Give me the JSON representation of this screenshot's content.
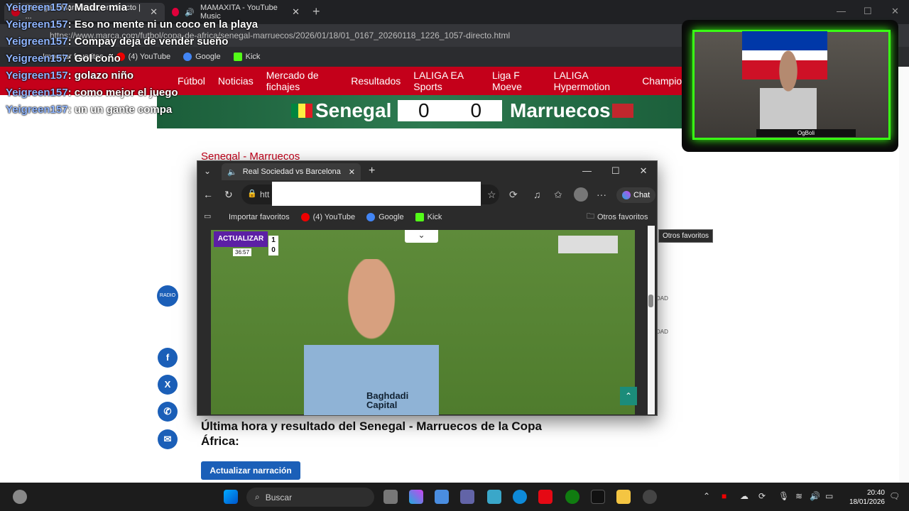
{
  "back_browser": {
    "tabs": [
      {
        "label": "Senegal - Marruecos, en directo | ..."
      },
      {
        "label": "MAMAXITA - YouTube Music"
      }
    ],
    "new_tab": "+",
    "url": "https://www.marca.com/futbol/copa-de-africa/senegal-marruecos/2026/01/18/01_0167_20260118_1226_1057-directo.html",
    "bookmarks": [
      "Importar favoritos",
      "(4) YouTube",
      "Google",
      "Kick"
    ]
  },
  "marca_nav": {
    "items": [
      "Fútbol",
      "Noticias",
      "Mercado de fichajes",
      "Resultados",
      "LALIGA EA Sports",
      "Liga F Moeve",
      "LALIGA Hypermotion",
      "Champions"
    ]
  },
  "score": {
    "home": "Senegal",
    "away": "Marruecos",
    "home_goals": "0",
    "away_goals": "0"
  },
  "article": {
    "top_title": "Senegal - Marruecos",
    "headline": "Última hora y resultado del Senegal - Marruecos de la Copa África:",
    "update_button": "Actualizar narración",
    "radio_label": "RADIO MARCA",
    "side_label_1": "DAD",
    "side_label_2": "DAD"
  },
  "social": {
    "facebook": "f",
    "x": "X",
    "whatsapp": "✆",
    "email": "✉"
  },
  "chat": [
    {
      "user": "Yeigreen157",
      "msg": "Madre mia"
    },
    {
      "user": "Yeigreen157",
      "msg": "Eso no mente ni un coco en la playa"
    },
    {
      "user": "Yeigreen157",
      "msg": "Compay deja de vender sueño"
    },
    {
      "user": "Yeigreen157",
      "msg": "Gol coño"
    },
    {
      "user": "Yeigreen157",
      "msg": "golazo niño"
    },
    {
      "user": "Yeigreen157",
      "msg": "como mejor el juego"
    },
    {
      "user": "Yeigreen157",
      "msg": "un "
    }
  ],
  "chat_overlap": "un gante compa",
  "webcam": {
    "name": "OgBoli"
  },
  "popup": {
    "tab_label": "Real Sociedad vs Barcelona",
    "url_prefix": "htt",
    "chat_button": "Chat",
    "bookmarks": [
      "Importar favoritos",
      "(4) YouTube",
      "Google",
      "Kick"
    ],
    "other_favorites": "Otros favoritos",
    "tooltip": "Otros favoritos",
    "video": {
      "actualizar": "ACTUALIZAR",
      "time": "36:57",
      "goals_home": "1",
      "goals_away": "0",
      "sponsor": "Baghdadi Capital"
    }
  },
  "taskbar": {
    "search": "Buscar",
    "time": "20:40",
    "date": "18/01/2026"
  },
  "colors": {
    "marca_red": "#c4001a",
    "webcam_border": "#39ff14",
    "chat_user": "#8fb5ff"
  }
}
